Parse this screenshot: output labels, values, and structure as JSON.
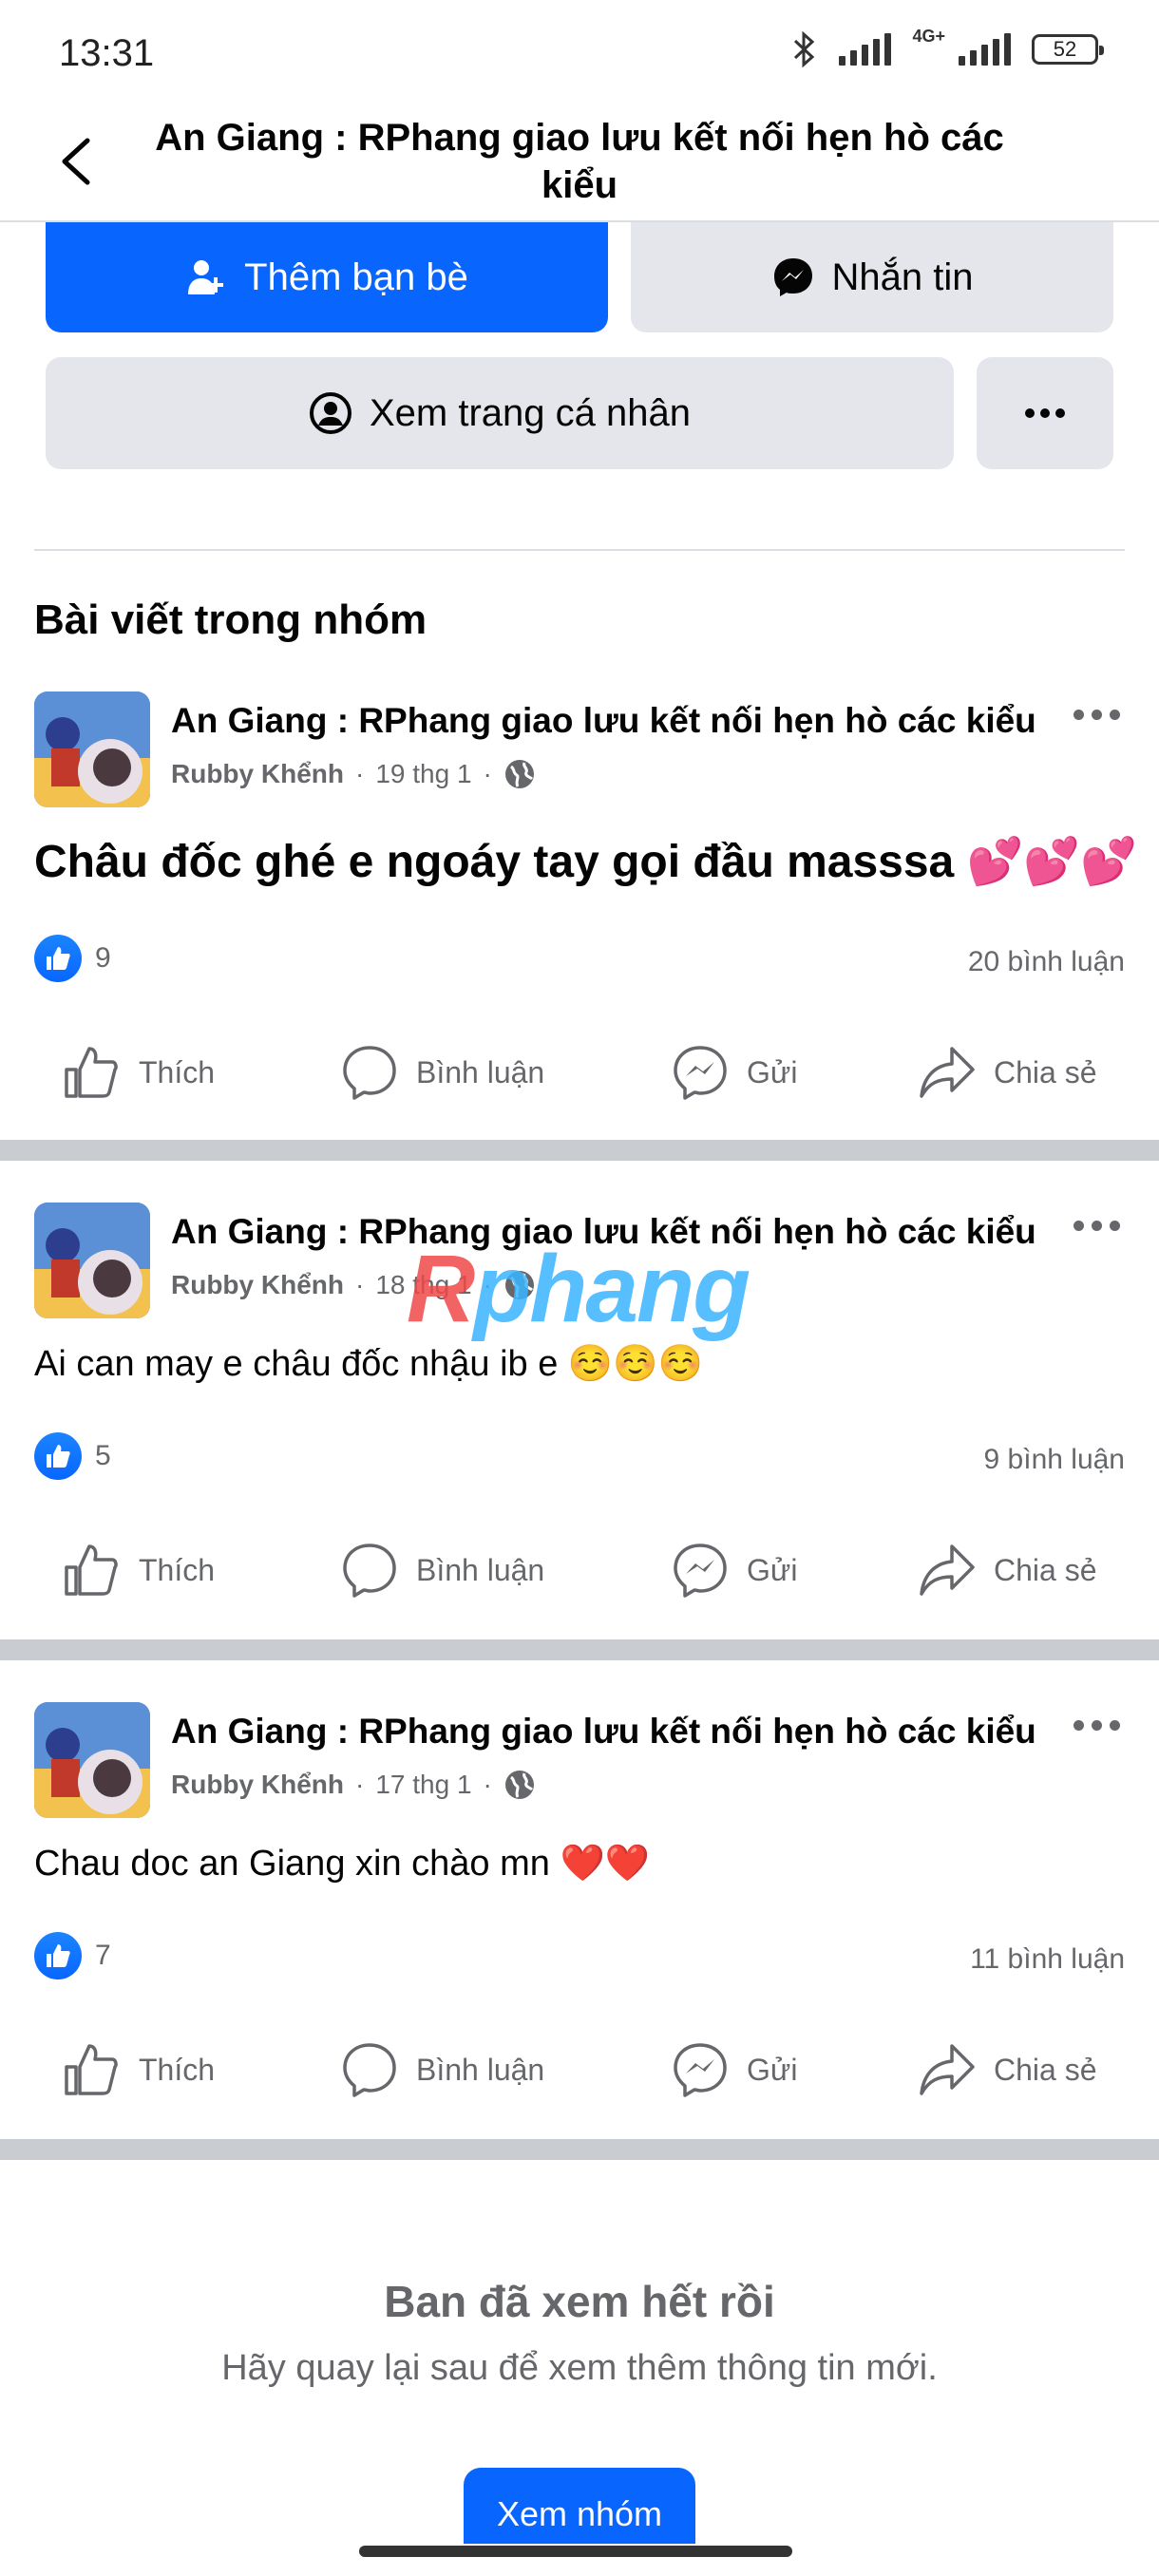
{
  "status_bar": {
    "time": "13:31",
    "network": "4G+",
    "battery": "52"
  },
  "header": {
    "title": "An Giang : RPhang giao lưu kết nối hẹn hò các kiểu"
  },
  "profile_actions": {
    "add_friend": "Thêm bạn bè",
    "message": "Nhắn tin",
    "view_profile": "Xem trang cá nhân"
  },
  "section_title": "Bài viết trong nhóm",
  "posts": [
    {
      "group": "An Giang : RPhang giao lưu kết nối hẹn hò các kiểu",
      "author": "Rubby Khểnh",
      "date": "19 thg 1",
      "text": "Châu đốc ghé e ngoáy tay gọi đầu masssa 💕💕💕",
      "likes": "9",
      "comments": "20 bình luận"
    },
    {
      "group": "An Giang : RPhang giao lưu kết nối hẹn hò các kiểu",
      "author": "Rubby Khểnh",
      "date": "18 thg 1",
      "text": "Ai can may e châu đốc nhậu ib e ☺️☺️☺️",
      "likes": "5",
      "comments": "9 bình luận"
    },
    {
      "group": "An Giang : RPhang giao lưu kết nối hẹn hò các kiểu",
      "author": "Rubby Khểnh",
      "date": "17 thg 1",
      "text": "Chau doc an Giang xin chào mn ❤️❤️",
      "likes": "7",
      "comments": "11 bình luận"
    }
  ],
  "post_actions": {
    "like": "Thích",
    "comment": "Bình luận",
    "send": "Gửi",
    "share": "Chia sẻ"
  },
  "feed_end": {
    "title": "Ban đã xem hết rồi",
    "subtitle": "Hãy quay lại sau để xem thêm thông tin mới.",
    "button": "Xem nhóm"
  },
  "watermark": {
    "part1": "R",
    "part2": "phang"
  },
  "colors": {
    "primary": "#0866ff",
    "secondary_bg": "#e4e6eb",
    "muted_text": "#65676b",
    "separator": "#c9ccd1"
  }
}
